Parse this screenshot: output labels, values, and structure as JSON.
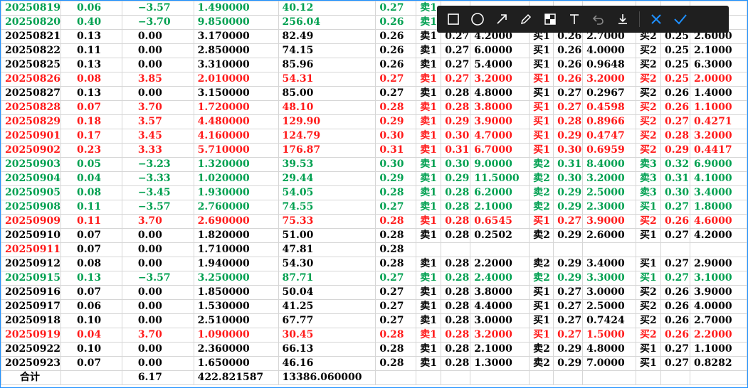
{
  "rows": [
    {
      "color": "green",
      "cells": [
        "20250819",
        "0.06",
        "−3.57",
        "1.490000",
        "40.12",
        "0.27",
        "卖1",
        "",
        "",
        "",
        "",
        "",
        "",
        "",
        ""
      ]
    },
    {
      "color": "green",
      "cells": [
        "20250820",
        "0.40",
        "−3.70",
        "9.850000",
        "256.04",
        "0.26",
        "卖1",
        "",
        "",
        "",
        "",
        "",
        "",
        "",
        ""
      ]
    },
    {
      "color": "black",
      "cells": [
        "20250821",
        "0.13",
        "0.00",
        "3.170000",
        "82.49",
        "0.26",
        "卖1",
        "0.27",
        "4.2000",
        "买1",
        "0.26",
        "2.7000",
        "买2",
        "0.25",
        "2.6000"
      ]
    },
    {
      "color": "black",
      "cells": [
        "20250822",
        "0.11",
        "0.00",
        "2.850000",
        "74.15",
        "0.26",
        "卖1",
        "0.27",
        "6.0000",
        "买1",
        "0.26",
        "4.0000",
        "买2",
        "0.25",
        "2.1000"
      ]
    },
    {
      "color": "black",
      "cells": [
        "20250825",
        "0.13",
        "0.00",
        "3.310000",
        "85.96",
        "0.26",
        "卖1",
        "0.27",
        "5.4000",
        "买1",
        "0.26",
        "0.9648",
        "买2",
        "0.25",
        "6.3000"
      ]
    },
    {
      "color": "red",
      "cells": [
        "20250826",
        "0.08",
        "3.85",
        "2.010000",
        "54.31",
        "0.27",
        "卖1",
        "0.27",
        "3.2000",
        "买1",
        "0.26",
        "3.2000",
        "买2",
        "0.25",
        "2.0000"
      ]
    },
    {
      "color": "black",
      "cells": [
        "20250827",
        "0.13",
        "0.00",
        "3.150000",
        "85.00",
        "0.27",
        "卖1",
        "0.28",
        "4.8000",
        "买1",
        "0.27",
        "0.2967",
        "买2",
        "0.26",
        "1.4000"
      ]
    },
    {
      "color": "red",
      "cells": [
        "20250828",
        "0.07",
        "3.70",
        "1.720000",
        "48.10",
        "0.28",
        "卖1",
        "0.28",
        "3.8000",
        "买1",
        "0.27",
        "0.4598",
        "买2",
        "0.26",
        "1.1000"
      ]
    },
    {
      "color": "red",
      "cells": [
        "20250829",
        "0.18",
        "3.57",
        "4.480000",
        "129.90",
        "0.29",
        "卖1",
        "0.29",
        "3.9000",
        "买1",
        "0.28",
        "0.8966",
        "买2",
        "0.27",
        "0.4271"
      ]
    },
    {
      "color": "red",
      "cells": [
        "20250901",
        "0.17",
        "3.45",
        "4.160000",
        "124.79",
        "0.30",
        "卖1",
        "0.30",
        "4.7000",
        "买1",
        "0.29",
        "0.4747",
        "买2",
        "0.28",
        "3.2000"
      ]
    },
    {
      "color": "red",
      "cells": [
        "20250902",
        "0.23",
        "3.33",
        "5.710000",
        "176.87",
        "0.31",
        "卖1",
        "0.31",
        "6.7000",
        "买1",
        "0.30",
        "0.6959",
        "买2",
        "0.29",
        "0.4417"
      ]
    },
    {
      "color": "green",
      "cells": [
        "20250903",
        "0.05",
        "−3.23",
        "1.320000",
        "39.53",
        "0.30",
        "卖1",
        "0.30",
        "9.0000",
        "卖2",
        "0.31",
        "8.4000",
        "卖3",
        "0.32",
        "6.9000"
      ]
    },
    {
      "color": "green",
      "cells": [
        "20250904",
        "0.04",
        "−3.33",
        "1.020000",
        "29.44",
        "0.29",
        "卖1",
        "0.29",
        "11.5000",
        "卖2",
        "0.30",
        "3.2000",
        "卖3",
        "0.31",
        "4.1000"
      ]
    },
    {
      "color": "green",
      "cells": [
        "20250905",
        "0.08",
        "−3.45",
        "1.930000",
        "54.05",
        "0.28",
        "卖1",
        "0.28",
        "6.2000",
        "卖2",
        "0.29",
        "2.5000",
        "卖3",
        "0.30",
        "3.4000"
      ]
    },
    {
      "color": "green",
      "cells": [
        "20250908",
        "0.11",
        "−3.57",
        "2.760000",
        "74.55",
        "0.27",
        "卖1",
        "0.28",
        "2.1000",
        "卖2",
        "0.29",
        "2.3000",
        "买1",
        "0.27",
        "1.8000"
      ]
    },
    {
      "color": "red",
      "cells": [
        "20250909",
        "0.11",
        "3.70",
        "2.690000",
        "75.33",
        "0.28",
        "卖1",
        "0.28",
        "0.6545",
        "买1",
        "0.27",
        "3.9000",
        "买2",
        "0.26",
        "4.6000"
      ]
    },
    {
      "color": "black",
      "cells": [
        "20250910",
        "0.07",
        "0.00",
        "1.820000",
        "51.00",
        "0.28",
        "卖1",
        "0.28",
        "0.2502",
        "卖2",
        "0.29",
        "2.6000",
        "买1",
        "0.27",
        "4.2000"
      ]
    },
    {
      "color": "black",
      "firstRed": true,
      "cells": [
        "20250911",
        "0.07",
        "0.00",
        "1.710000",
        "47.81",
        "0.28",
        "",
        "",
        "",
        "",
        "",
        "",
        "",
        "",
        ""
      ]
    },
    {
      "color": "black",
      "cells": [
        "20250912",
        "0.08",
        "0.00",
        "1.940000",
        "54.30",
        "0.28",
        "卖1",
        "0.28",
        "2.2000",
        "卖2",
        "0.29",
        "3.4000",
        "买1",
        "0.27",
        "2.9000"
      ]
    },
    {
      "color": "green",
      "cells": [
        "20250915",
        "0.13",
        "−3.57",
        "3.250000",
        "87.71",
        "0.27",
        "卖1",
        "0.28",
        "2.4000",
        "卖2",
        "0.29",
        "3.3000",
        "买1",
        "0.27",
        "3.1000"
      ]
    },
    {
      "color": "black",
      "cells": [
        "20250916",
        "0.07",
        "0.00",
        "1.850000",
        "50.04",
        "0.27",
        "卖1",
        "0.28",
        "3.8000",
        "买1",
        "0.27",
        "3.0000",
        "买2",
        "0.26",
        "3.9000"
      ]
    },
    {
      "color": "black",
      "cells": [
        "20250917",
        "0.06",
        "0.00",
        "1.530000",
        "41.25",
        "0.27",
        "卖1",
        "0.28",
        "4.4000",
        "买1",
        "0.27",
        "2.5000",
        "买2",
        "0.26",
        "4.0000"
      ]
    },
    {
      "color": "black",
      "cells": [
        "20250918",
        "0.10",
        "0.00",
        "2.510000",
        "67.77",
        "0.27",
        "卖1",
        "0.28",
        "3.0000",
        "买1",
        "0.27",
        "0.7424",
        "买2",
        "0.26",
        "2.7000"
      ]
    },
    {
      "color": "red",
      "cells": [
        "20250919",
        "0.04",
        "3.70",
        "1.090000",
        "30.45",
        "0.28",
        "卖1",
        "0.28",
        "3.2000",
        "买1",
        "0.27",
        "1.5000",
        "买2",
        "0.26",
        "2.2000"
      ]
    },
    {
      "color": "black",
      "cells": [
        "20250922",
        "0.10",
        "0.00",
        "2.360000",
        "66.13",
        "0.28",
        "卖1",
        "0.28",
        "2.1000",
        "卖2",
        "0.29",
        "4.8000",
        "买1",
        "0.27",
        "1.1000"
      ]
    },
    {
      "color": "black",
      "cells": [
        "20250923",
        "0.07",
        "0.00",
        "1.650000",
        "46.16",
        "0.28",
        "卖1",
        "0.28",
        "1.3000",
        "卖2",
        "0.29",
        "7.0000",
        "买1",
        "0.27",
        "0.8282"
      ]
    }
  ],
  "total": {
    "label": "合计",
    "change_sum": "6.17",
    "volume_sum": "422.821587",
    "amount_sum": "13386.060000"
  },
  "colors": {
    "red": "#ff1a1a",
    "green": "#00a050",
    "black": "#000000",
    "toolbar_bg": "#1f1f1f",
    "accent": "#1e90ff"
  },
  "toolbar": [
    "rectangle-icon",
    "circle-icon",
    "arrow-icon",
    "pen-icon",
    "mosaic-icon",
    "text-icon",
    "undo-icon",
    "download-icon",
    "cancel-icon",
    "confirm-icon"
  ]
}
